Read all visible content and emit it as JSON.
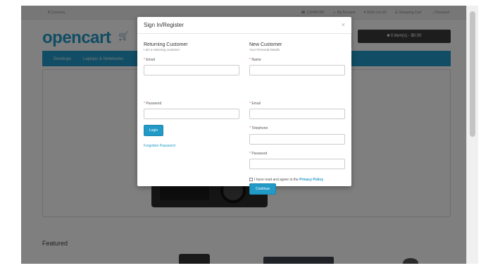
{
  "store": {
    "currency": "$ Currency",
    "topnav": [
      "☎ 123456789",
      "☺ My Account",
      "♥ Wish List (0)",
      "☰ Shopping Cart",
      "→ Checkout"
    ],
    "logo": "opencart",
    "cart_button": "■ 0 item(s) - $0.00",
    "menu": [
      "Desktops",
      "Laptops & Notebooks"
    ],
    "featured_heading": "Featured"
  },
  "modal": {
    "title": "Sign In/Register",
    "close": "×",
    "login": {
      "heading": "Returning Customer",
      "subheading": "I am a returning customer",
      "email_label": "Email",
      "password_label": "Password",
      "login_button": "Login",
      "forgot_link": "Forgotten Password"
    },
    "register": {
      "heading": "New Customer",
      "subheading": "Your Personal Details",
      "name_label": "Name",
      "email_label": "Email",
      "telephone_label": "Telephone",
      "password_label": "Password",
      "agree_text": "I have read and agree to the",
      "policy_link": "Privacy Policy",
      "continue_button": "Continue"
    },
    "required_marker": "*"
  },
  "colors": {
    "accent": "#229ac8",
    "overlay": "rgba(0,0,0,0.5)",
    "cart_button": "#3a3a3a"
  }
}
